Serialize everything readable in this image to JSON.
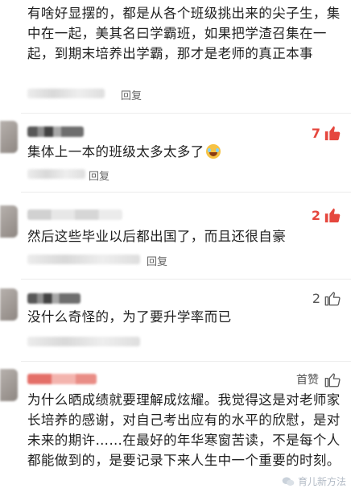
{
  "comments": [
    {
      "text": "有啥好显摆的，都是从各个班级挑出来的尖子生，集中在一起，美其名曰学霸班，如果把学渣召集在一起，到期末培养出学霸，那才是老师的真正本事",
      "reply_label": "回复"
    },
    {
      "text": "集体上一本的班级太多太多了",
      "emoji": "laughing-with-tears",
      "like_count": "7",
      "reply_label": "回复"
    },
    {
      "text": "然后这些毕业以后都出国了，而且还很自豪",
      "like_count": "2",
      "reply_label": "回复"
    },
    {
      "text": "没什么奇怪的，为了要升学率而已",
      "like_count": "2",
      "reply_label": ""
    },
    {
      "text": "为什么晒成绩就要理解成炫耀。我觉得这是对老师家长培养的感谢，对自己考出应有的水平的欣慰，是对未来的期许……在最好的年华寒窗苦读，不是每个人都能做到的，是要记录下来人生中一个重要的时刻。",
      "badge": "首赞",
      "reply_label": ""
    }
  ],
  "watermark": {
    "text": "育儿新方法"
  },
  "colors": {
    "accent_red": "#e5473e",
    "text": "#1f1f1f",
    "meta": "#666666"
  },
  "icons": {
    "thumb": "thumbs-up-icon",
    "emoji": "laughing-emoji-icon",
    "watermark": "wechat-logo-icon"
  }
}
